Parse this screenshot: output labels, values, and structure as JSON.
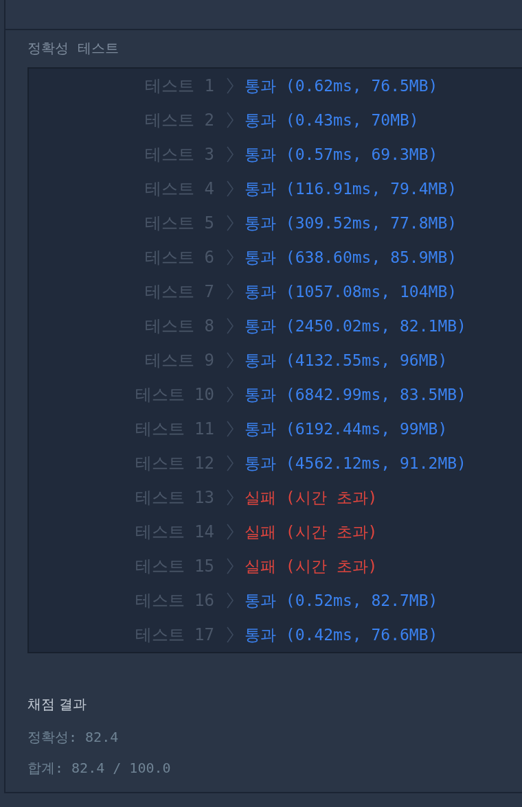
{
  "section_title": "정확성  테스트",
  "tests": [
    {
      "label": "테스트 1",
      "kind": "pass",
      "result": "통과 (0.62ms, 76.5MB)"
    },
    {
      "label": "테스트 2",
      "kind": "pass",
      "result": "통과 (0.43ms, 70MB)"
    },
    {
      "label": "테스트 3",
      "kind": "pass",
      "result": "통과 (0.57ms, 69.3MB)"
    },
    {
      "label": "테스트 4",
      "kind": "pass",
      "result": "통과 (116.91ms, 79.4MB)"
    },
    {
      "label": "테스트 5",
      "kind": "pass",
      "result": "통과 (309.52ms, 77.8MB)"
    },
    {
      "label": "테스트 6",
      "kind": "pass",
      "result": "통과 (638.60ms, 85.9MB)"
    },
    {
      "label": "테스트 7",
      "kind": "pass",
      "result": "통과 (1057.08ms, 104MB)"
    },
    {
      "label": "테스트 8",
      "kind": "pass",
      "result": "통과 (2450.02ms, 82.1MB)"
    },
    {
      "label": "테스트 9",
      "kind": "pass",
      "result": "통과 (4132.55ms, 96MB)"
    },
    {
      "label": "테스트 10",
      "kind": "pass",
      "result": "통과 (6842.99ms, 83.5MB)"
    },
    {
      "label": "테스트 11",
      "kind": "pass",
      "result": "통과 (6192.44ms, 99MB)"
    },
    {
      "label": "테스트 12",
      "kind": "pass",
      "result": "통과 (4562.12ms, 91.2MB)"
    },
    {
      "label": "테스트 13",
      "kind": "fail",
      "result": "실패 (시간 초과)"
    },
    {
      "label": "테스트 14",
      "kind": "fail",
      "result": "실패 (시간 초과)"
    },
    {
      "label": "테스트 15",
      "kind": "fail",
      "result": "실패 (시간 초과)"
    },
    {
      "label": "테스트 16",
      "kind": "pass",
      "result": "통과 (0.52ms, 82.7MB)"
    },
    {
      "label": "테스트 17",
      "kind": "pass",
      "result": "통과 (0.42ms, 76.6MB)"
    }
  ],
  "summary": {
    "title": "채점 결과",
    "lines": [
      "정확성: 82.4",
      "합계: 82.4 / 100.0"
    ]
  }
}
